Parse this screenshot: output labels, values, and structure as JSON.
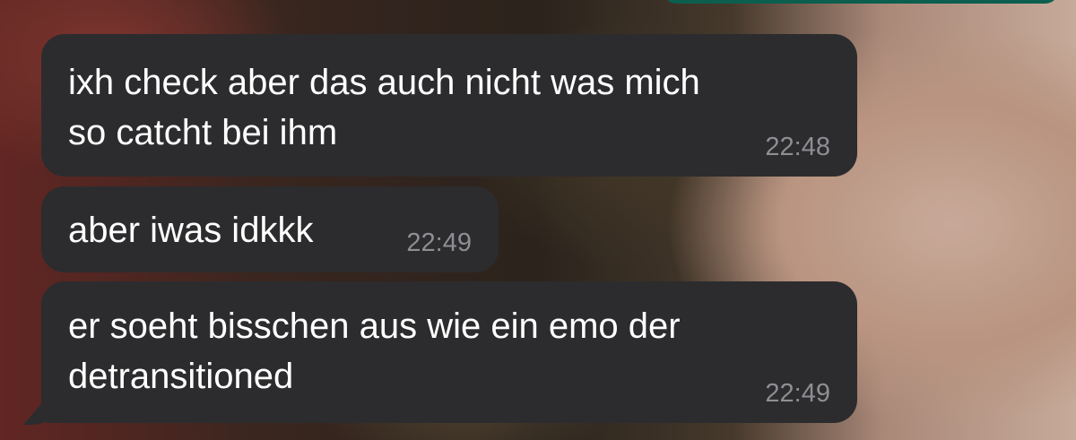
{
  "messages": [
    {
      "text": "ixh check aber das auch nicht was mich\nso catcht bei ihm",
      "time": "22:48"
    },
    {
      "text": "aber iwas idkkk",
      "time": "22:49"
    },
    {
      "text": "er soeht bisschen aus wie ein emo der\ndetransitioned",
      "time": "22:49"
    }
  ],
  "colors": {
    "incoming_bubble": "#2c2c2e",
    "message_text": "#ffffff",
    "timestamp": "#8e8e93",
    "outgoing_bubble": "#0c5f4e"
  }
}
